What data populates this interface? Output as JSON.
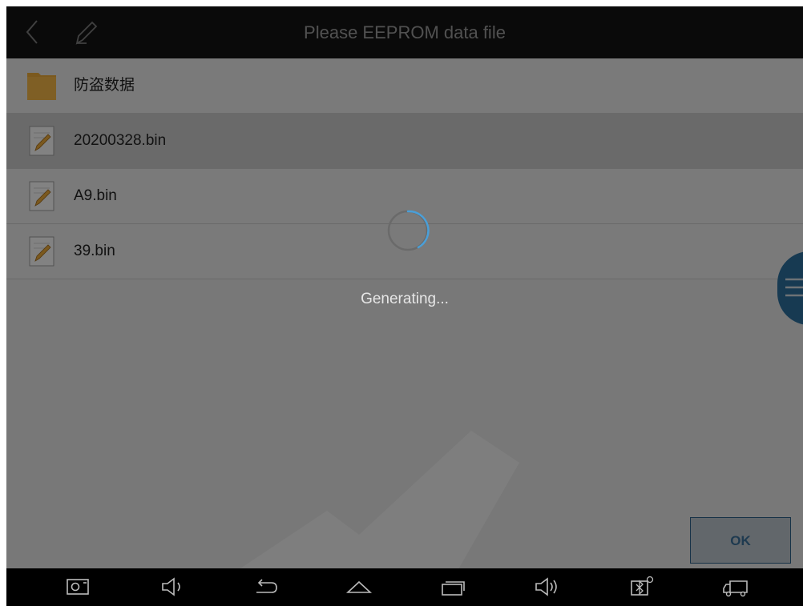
{
  "header": {
    "title": "Please EEPROM data file"
  },
  "files": [
    {
      "name": "防盗数据",
      "type": "folder",
      "icon": "folder-icon"
    },
    {
      "name": "20200328.bin",
      "type": "file",
      "icon": "document-pencil-icon",
      "selected": true
    },
    {
      "name": "A9.bin",
      "type": "file",
      "icon": "document-pencil-icon"
    },
    {
      "name": "39.bin",
      "type": "file",
      "icon": "document-pencil-icon"
    }
  ],
  "loading": {
    "message": "Generating..."
  },
  "buttons": {
    "ok_label": "OK"
  },
  "navbar": {
    "icons": [
      "screenshot-icon",
      "volume-down-icon",
      "back-arrow-icon",
      "home-icon",
      "recent-apps-icon",
      "volume-up-icon",
      "bluetooth-settings-icon",
      "vci-truck-icon"
    ]
  },
  "colors": {
    "accent": "#2c6f9c",
    "spinner": "#4a9fd8",
    "topbar": "#141414"
  }
}
